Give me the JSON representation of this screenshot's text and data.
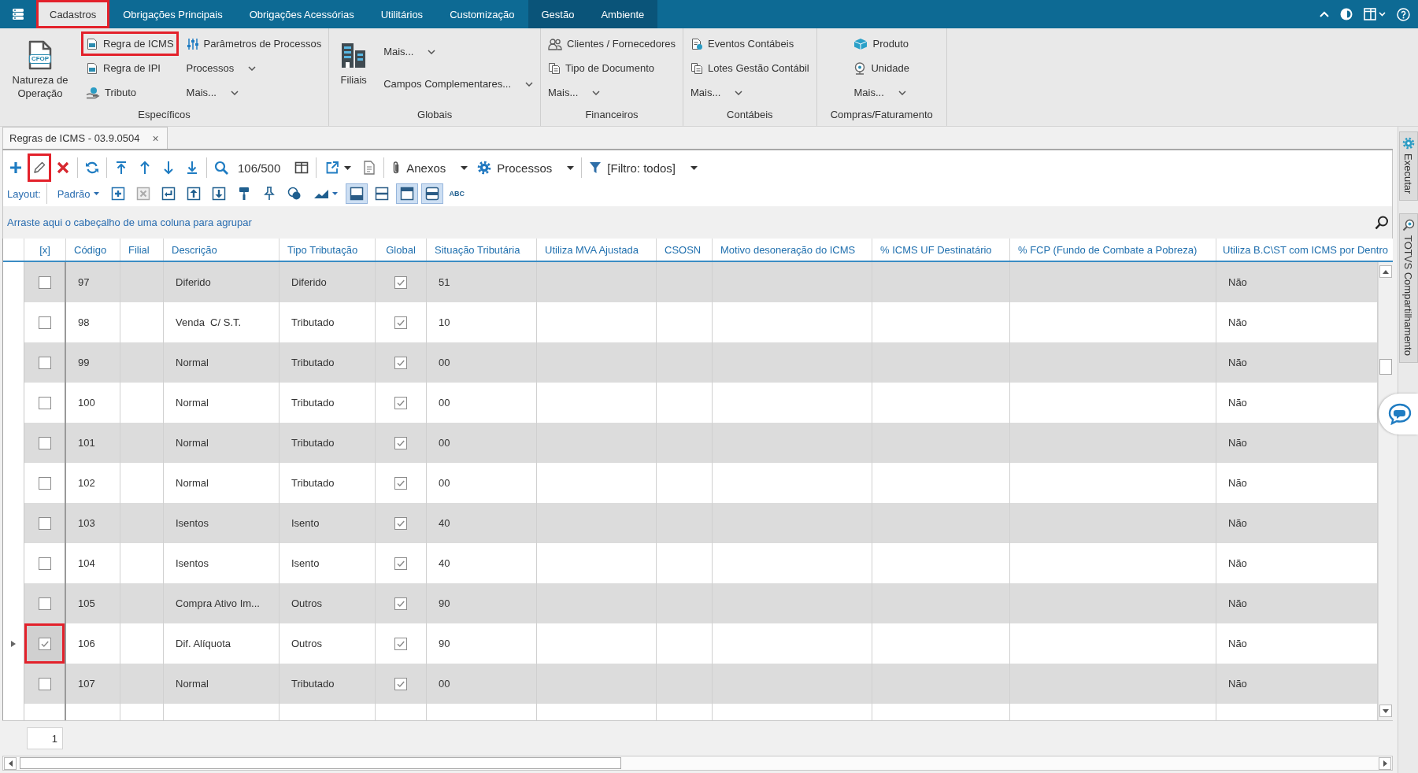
{
  "menu_bar": {
    "tabs": [
      {
        "label": "Cadastros",
        "kind": "main",
        "selected": true,
        "highlighted": true
      },
      {
        "label": "Obrigações Principais",
        "kind": "main",
        "selected": false,
        "highlighted": false
      },
      {
        "label": "Obrigações Acessórias",
        "kind": "main",
        "selected": false,
        "highlighted": false
      },
      {
        "label": "Utilitários",
        "kind": "main",
        "selected": false,
        "highlighted": false
      },
      {
        "label": "Customização",
        "kind": "main",
        "selected": false,
        "highlighted": false
      },
      {
        "label": "Gestão",
        "kind": "context",
        "selected": false,
        "highlighted": false
      },
      {
        "label": "Ambiente",
        "kind": "context",
        "selected": false,
        "highlighted": false
      }
    ]
  },
  "ribbon": {
    "groups": [
      {
        "label": "Específicos",
        "columns": [
          [
            {
              "kind": "large",
              "label": "Natureza de Operação",
              "badge": "CFOP",
              "highlighted": false
            }
          ],
          [
            {
              "kind": "small",
              "label": "Regra de ICMS",
              "highlighted": true
            },
            {
              "kind": "small",
              "label": "Regra de IPI",
              "highlighted": false
            },
            {
              "kind": "small",
              "label": "Tributo",
              "highlighted": false
            }
          ],
          [
            {
              "kind": "small",
              "label": "Parâmetros de Processos",
              "highlighted": false
            },
            {
              "kind": "dropdown",
              "label": "Processos",
              "highlighted": false
            },
            {
              "kind": "dropdown",
              "label": "Mais...",
              "highlighted": false
            }
          ]
        ]
      },
      {
        "label": "Globais",
        "columns": [
          [
            {
              "kind": "large",
              "label": "Filiais",
              "highlighted": false
            }
          ],
          [
            {
              "kind": "dropdown",
              "label": "Mais...",
              "highlighted": false
            },
            {
              "kind": "dropdown",
              "label": "Campos Complementares...",
              "highlighted": false
            }
          ]
        ]
      },
      {
        "label": "Financeiros",
        "columns": [
          [
            {
              "kind": "small",
              "label": "Clientes / Fornecedores",
              "highlighted": false
            },
            {
              "kind": "small",
              "label": "Tipo de Documento",
              "highlighted": false
            },
            {
              "kind": "dropdown",
              "label": "Mais...",
              "highlighted": false
            }
          ]
        ]
      },
      {
        "label": "Contábeis",
        "columns": [
          [
            {
              "kind": "small",
              "label": "Eventos Contábeis",
              "highlighted": false
            },
            {
              "kind": "small",
              "label": "Lotes Gestão Contábil",
              "highlighted": false
            },
            {
              "kind": "dropdown",
              "label": "Mais...",
              "highlighted": false
            }
          ]
        ]
      },
      {
        "label": "Compras/Faturamento",
        "columns": [
          [
            {
              "kind": "small",
              "label": "Produto",
              "highlighted": false
            },
            {
              "kind": "small",
              "label": "Unidade",
              "highlighted": false
            },
            {
              "kind": "dropdown",
              "label": "Mais...",
              "highlighted": false
            }
          ]
        ]
      }
    ]
  },
  "document_tabs": [
    {
      "label": "Regras de ICMS - 03.9.0504",
      "close": "×",
      "selected": true
    }
  ],
  "toolbar": {
    "edit_button": {
      "highlighted": true
    },
    "record_counter": "106/500",
    "menus": [
      {
        "label": "Anexos"
      },
      {
        "label": "Processos"
      },
      {
        "label": "[Filtro: todos]"
      }
    ]
  },
  "layout_bar": {
    "label": "Layout:",
    "preset": "Padrão",
    "toggles": [
      {
        "on": true
      },
      {
        "on": false
      },
      {
        "on": true
      },
      {
        "on": true
      }
    ],
    "text_button": "ABC"
  },
  "group_panel": {
    "hint": "Arraste aqui o cabeçalho de uma coluna para agrupar"
  },
  "table": {
    "columns": [
      "[x]",
      "Código",
      "Filial",
      "Descrição",
      "Tipo Tributação",
      "Global",
      "Situação Tributária",
      "Utiliza MVA Ajustada",
      "CSOSN",
      "Motivo desoneração do ICMS",
      "% ICMS UF Destinatário",
      "% FCP (Fundo de Combate a Pobreza)",
      "Utiliza B.C\\ST com ICMS por Dentro"
    ],
    "rows": [
      {
        "selected": false,
        "checked": false,
        "checkbox_highlighted": false,
        "code": "97",
        "description": "Diferido",
        "tax_type": "Diferido",
        "global": true,
        "tax_situation": "51",
        "bc_st_inside": "Não"
      },
      {
        "selected": false,
        "checked": false,
        "checkbox_highlighted": false,
        "code": "98",
        "description": "Venda  C/ S.T.",
        "tax_type": "Tributado",
        "global": true,
        "tax_situation": "10",
        "bc_st_inside": "Não"
      },
      {
        "selected": false,
        "checked": false,
        "checkbox_highlighted": false,
        "code": "99",
        "description": "Normal",
        "tax_type": "Tributado",
        "global": true,
        "tax_situation": "00",
        "bc_st_inside": "Não"
      },
      {
        "selected": false,
        "checked": false,
        "checkbox_highlighted": false,
        "code": "100",
        "description": "Normal",
        "tax_type": "Tributado",
        "global": true,
        "tax_situation": "00",
        "bc_st_inside": "Não"
      },
      {
        "selected": false,
        "checked": false,
        "checkbox_highlighted": false,
        "code": "101",
        "description": "Normal",
        "tax_type": "Tributado",
        "global": true,
        "tax_situation": "00",
        "bc_st_inside": "Não"
      },
      {
        "selected": false,
        "checked": false,
        "checkbox_highlighted": false,
        "code": "102",
        "description": "Normal",
        "tax_type": "Tributado",
        "global": true,
        "tax_situation": "00",
        "bc_st_inside": "Não"
      },
      {
        "selected": false,
        "checked": false,
        "checkbox_highlighted": false,
        "code": "103",
        "description": "Isentos",
        "tax_type": "Isento",
        "global": true,
        "tax_situation": "40",
        "bc_st_inside": "Não"
      },
      {
        "selected": false,
        "checked": false,
        "checkbox_highlighted": false,
        "code": "104",
        "description": "Isentos",
        "tax_type": "Isento",
        "global": true,
        "tax_situation": "40",
        "bc_st_inside": "Não"
      },
      {
        "selected": false,
        "checked": false,
        "checkbox_highlighted": false,
        "code": "105",
        "description": "Compra Ativo Im...",
        "tax_type": "Outros",
        "global": true,
        "tax_situation": "90",
        "bc_st_inside": "Não"
      },
      {
        "selected": true,
        "checked": true,
        "checkbox_highlighted": true,
        "code": "106",
        "description": "Dif. Alíquota",
        "tax_type": "Outros",
        "global": true,
        "tax_situation": "90",
        "bc_st_inside": "Não"
      },
      {
        "selected": false,
        "checked": false,
        "checkbox_highlighted": false,
        "code": "107",
        "description": "Normal",
        "tax_type": "Tributado",
        "global": true,
        "tax_situation": "00",
        "bc_st_inside": "Não"
      }
    ]
  },
  "pager": {
    "page": "1"
  },
  "side_panel": {
    "tabs": [
      {
        "label": "Executar"
      },
      {
        "label": "TOTVS Compartilhamento"
      }
    ]
  }
}
